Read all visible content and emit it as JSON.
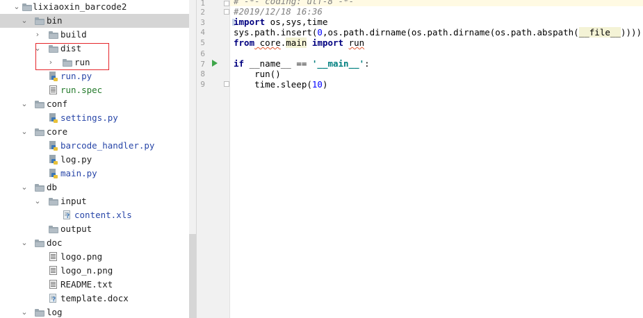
{
  "tree": {
    "items": [
      {
        "label": "lixiaoxin_barcode2",
        "type": "folder",
        "expanded": true,
        "color": "default"
      },
      {
        "label": "bin",
        "type": "folder",
        "expanded": true,
        "selected": true,
        "color": "default"
      },
      {
        "label": "build",
        "type": "folder",
        "expanded": false,
        "color": "default"
      },
      {
        "label": "dist",
        "type": "folder",
        "expanded": true,
        "color": "default"
      },
      {
        "label": "run",
        "type": "folder",
        "expanded": false,
        "color": "default"
      },
      {
        "label": "run.py",
        "type": "python",
        "color": "blue"
      },
      {
        "label": "run.spec",
        "type": "text",
        "color": "green"
      },
      {
        "label": "conf",
        "type": "folder",
        "expanded": true,
        "color": "default"
      },
      {
        "label": "settings.py",
        "type": "python",
        "color": "blue"
      },
      {
        "label": "core",
        "type": "folder",
        "expanded": true,
        "color": "default"
      },
      {
        "label": "barcode_handler.py",
        "type": "python",
        "color": "blue"
      },
      {
        "label": "log.py",
        "type": "python",
        "color": "default"
      },
      {
        "label": "main.py",
        "type": "python",
        "color": "blue"
      },
      {
        "label": "db",
        "type": "folder",
        "expanded": true,
        "color": "default"
      },
      {
        "label": "input",
        "type": "folder",
        "expanded": true,
        "color": "default"
      },
      {
        "label": "content.xls",
        "type": "unknown",
        "color": "blue"
      },
      {
        "label": "output",
        "type": "folder",
        "color": "default"
      },
      {
        "label": "doc",
        "type": "folder",
        "expanded": true,
        "color": "default"
      },
      {
        "label": "logo.png",
        "type": "image",
        "color": "default"
      },
      {
        "label": "logo_n.png",
        "type": "image",
        "color": "default"
      },
      {
        "label": "README.txt",
        "type": "text",
        "color": "default"
      },
      {
        "label": "template.docx",
        "type": "unknown",
        "color": "default"
      },
      {
        "label": "log",
        "type": "folder",
        "expanded": true,
        "color": "default"
      }
    ]
  },
  "editor": {
    "line_numbers": [
      "1",
      "2",
      "3",
      "4",
      "5",
      "6",
      "7",
      "8",
      "9"
    ],
    "lines": {
      "l1": "# -*- coding: utf-8 -*-",
      "l2": "#2019/12/18 16:36",
      "l3_kw": "import",
      "l3_rest": " os,sys,time",
      "l4_a": "sys.path.insert(",
      "l4_num": "0",
      "l4_b": ",os.path.dirname(os.path.dirname(os.path.abspath(",
      "l4_file": "__file__",
      "l4_c": "))))",
      "l6_from": "from",
      "l6_mod_a": " core",
      "l6_dot": ".",
      "l6_mod_b": "main",
      "l6_import": " import",
      "l6_sp": " ",
      "l6_name": "run",
      "l8_if": "if",
      "l8_name": " __name__ == ",
      "l8_str": "'__main__'",
      "l8_colon": ":",
      "l9": "    run()",
      "l10_a": "    time.sleep(",
      "l10_num": "10",
      "l10_b": ")"
    }
  },
  "colors": {
    "folder_icon": "#9aa7b0",
    "python_blue": "#3d77b7",
    "python_yellow": "#e8c13a",
    "label_blue": "#2846a8",
    "label_green": "#247a2b",
    "keyword": "#000080",
    "comment": "#808080",
    "number": "#0000ff",
    "string": "#008080",
    "highlight_box": "#e5252a",
    "selection": "#d5d5d5",
    "run_icon": "#3fa64a"
  },
  "icons": {
    "expanded": "chevron-down-icon",
    "collapsed": "chevron-right-icon",
    "folder": "folder-icon",
    "python": "python-file-icon",
    "text": "text-file-icon",
    "unknown": "unknown-file-icon",
    "run": "run-arrow-icon"
  }
}
